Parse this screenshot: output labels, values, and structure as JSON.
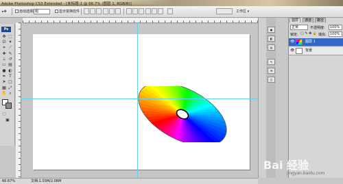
{
  "window": {
    "title": "Adobe Photoshop CS3 Extended - [未标题-1 @ 66.7% (图层 1, RGB/8)]"
  },
  "options_bar": {
    "auto_select_label": "自动选择图",
    "auto_select_value": "组",
    "show_transform_label": "显示变换控件",
    "workspace_label": "工作区 ▾"
  },
  "toolbox": {
    "badge": "Ps"
  },
  "status": {
    "zoom": "66.67%",
    "doc_info": "文档:1.03M/2.06M"
  },
  "layers_panel": {
    "tabs": [
      "图层",
      "通道",
      "路径"
    ],
    "blend_mode": "正常",
    "opacity_label": "不透明度:",
    "opacity_value": "100%",
    "lock_label": "锁定:",
    "fill_label": "填充:",
    "fill_value": "100%",
    "layers": [
      {
        "name": "图层 1",
        "selected": true
      },
      {
        "name": "背景",
        "selected": false
      }
    ]
  },
  "watermark": {
    "text": "Bai 经验",
    "url": "jingyan.baidu.com"
  },
  "colors": {
    "accent": "#3168c6",
    "guide": "#5fd3f2",
    "canvas_bg": "#c6c6c6"
  }
}
